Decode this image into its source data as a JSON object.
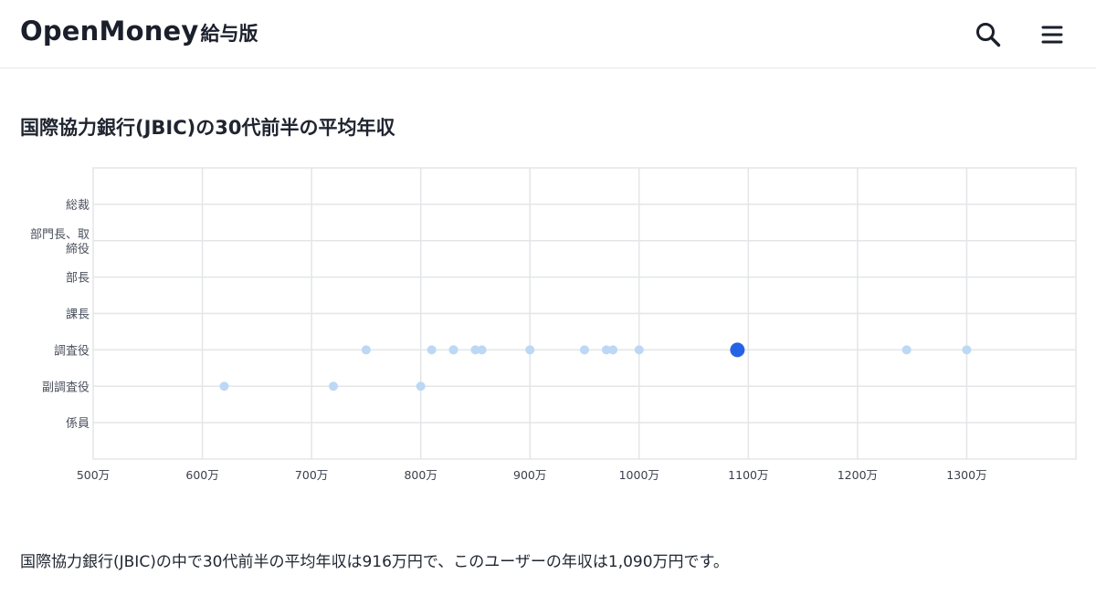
{
  "header": {
    "logo_main": "OpenMoney",
    "logo_sub": "給与版",
    "search_icon": "search-icon",
    "menu_icon": "hamburger-menu-icon"
  },
  "page": {
    "title": "国際協力銀行(JBIC)の30代前半の平均年収",
    "summary": "国際協力銀行(JBIC)の中で30代前半の平均年収は916万円で、このユーザーの年収は1,090万円です。"
  },
  "colors": {
    "point": "#bcd8f5",
    "highlight": "#2563e6",
    "grid": "#e3e5e8"
  },
  "chart_data": {
    "type": "scatter",
    "xlim": [
      500,
      1400
    ],
    "x_ticks": [
      {
        "value": 500,
        "label": "500万"
      },
      {
        "value": 600,
        "label": "600万"
      },
      {
        "value": 700,
        "label": "700万"
      },
      {
        "value": 800,
        "label": "800万"
      },
      {
        "value": 900,
        "label": "900万"
      },
      {
        "value": 1000,
        "label": "1000万"
      },
      {
        "value": 1100,
        "label": "1100万"
      },
      {
        "value": 1200,
        "label": "1200万"
      },
      {
        "value": 1300,
        "label": "1300万"
      }
    ],
    "categories": [
      "総裁",
      "部門長、取締役",
      "部長",
      "課長",
      "調査役",
      "副調査役",
      "係員"
    ],
    "category_lines": [
      [
        "総裁"
      ],
      [
        "部門長、取",
        "締役"
      ],
      [
        "部長"
      ],
      [
        "課長"
      ],
      [
        "調査役"
      ],
      [
        "副調査役"
      ],
      [
        "係員"
      ]
    ],
    "grid": true,
    "points": [
      {
        "x": 750,
        "y": "調査役"
      },
      {
        "x": 810,
        "y": "調査役"
      },
      {
        "x": 830,
        "y": "調査役"
      },
      {
        "x": 830,
        "y": "調査役"
      },
      {
        "x": 850,
        "y": "調査役"
      },
      {
        "x": 856,
        "y": "調査役"
      },
      {
        "x": 900,
        "y": "調査役"
      },
      {
        "x": 950,
        "y": "調査役"
      },
      {
        "x": 970,
        "y": "調査役"
      },
      {
        "x": 976,
        "y": "調査役"
      },
      {
        "x": 1000,
        "y": "調査役"
      },
      {
        "x": 1245,
        "y": "調査役"
      },
      {
        "x": 1300,
        "y": "調査役"
      },
      {
        "x": 620,
        "y": "副調査役"
      },
      {
        "x": 720,
        "y": "副調査役"
      },
      {
        "x": 800,
        "y": "副調査役"
      }
    ],
    "highlight": {
      "x": 1090,
      "y": "調査役"
    }
  }
}
